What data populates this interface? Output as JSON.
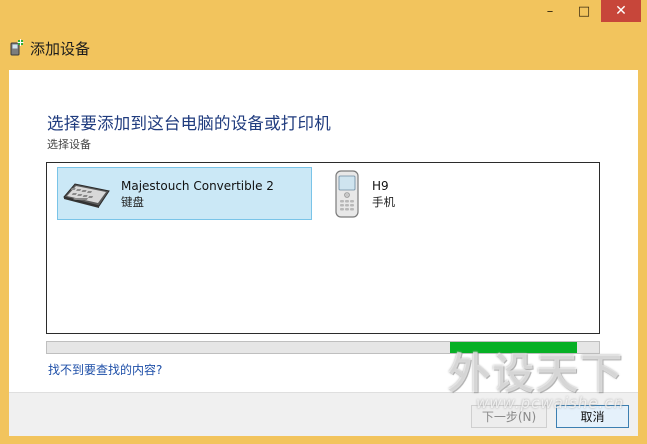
{
  "window": {
    "title": "添加设备",
    "controls": {
      "minimize": "–",
      "maximize": "□",
      "close": "✕"
    }
  },
  "main": {
    "heading": "选择要添加到这台电脑的设备或打印机",
    "subheading": "选择设备",
    "devices": [
      {
        "name": "Majestouch Convertible 2",
        "type": "键盘",
        "icon": "keyboard-icon",
        "selected": true
      },
      {
        "name": "H9",
        "type": "手机",
        "icon": "phone-icon",
        "selected": false
      }
    ],
    "help_link": "找不到要查找的内容?"
  },
  "footer": {
    "next_label": "下一步(N)",
    "cancel_label": "取消"
  },
  "watermark": {
    "main": "外设天下",
    "url": "www.pcwaishe.cn"
  },
  "colors": {
    "frame": "#F2C45D",
    "close_button": "#C7463A",
    "heading": "#1F3B7E",
    "selection": "#CBE8F6",
    "progress": "#06B025",
    "link": "#1E4FA8"
  }
}
